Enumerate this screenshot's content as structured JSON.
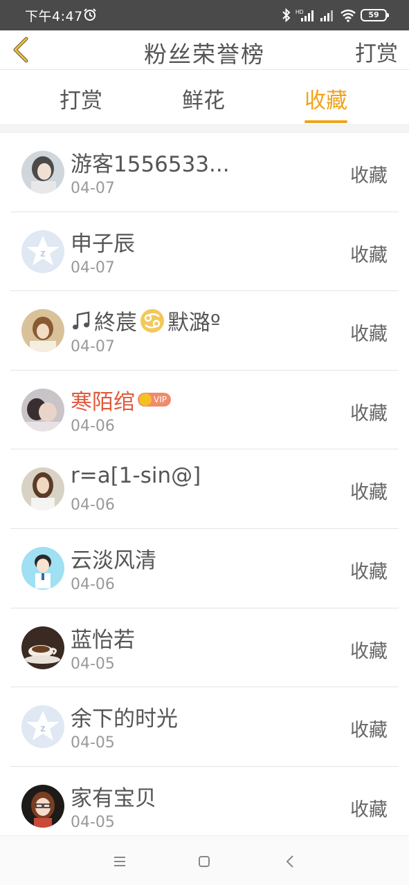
{
  "status_bar": {
    "time": "下午4:47",
    "battery": "59",
    "icons": [
      "alarm-icon",
      "bluetooth-icon",
      "hd-signal-icon",
      "signal-icon",
      "wifi-icon",
      "battery-icon"
    ]
  },
  "header": {
    "title": "粉丝荣誉榜",
    "action": "打赏",
    "back_icon": "chevron-left-icon"
  },
  "tabs": [
    {
      "label": "打赏",
      "active": false
    },
    {
      "label": "鲜花",
      "active": false
    },
    {
      "label": "收藏",
      "active": true
    }
  ],
  "colors": {
    "accent": "#f0a31a",
    "vip_name": "#e05a3c",
    "status_bar": "#4a4a4a"
  },
  "list": [
    {
      "name": "游客1556533...",
      "date": "04-07",
      "action": "收藏",
      "avatar": "photo-avatar"
    },
    {
      "name": "申子辰",
      "date": "04-07",
      "action": "收藏",
      "avatar": "default-qq-avatar"
    },
    {
      "name": "終莀",
      "name_suffix": "默潞º",
      "date": "04-07",
      "action": "收藏",
      "avatar": "photo-avatar",
      "icons": [
        "music-note-icon",
        "cancer-zodiac-icon"
      ]
    },
    {
      "name": "寒陌绾",
      "date": "04-06",
      "action": "收藏",
      "avatar": "photo-avatar",
      "vip": "VIP"
    },
    {
      "name": "r=a[1-sin@]",
      "date": "04-06",
      "action": "收藏",
      "avatar": "photo-avatar"
    },
    {
      "name": "云淡风清",
      "date": "04-06",
      "action": "收藏",
      "avatar": "cartoon-avatar"
    },
    {
      "name": "蓝怡若",
      "date": "04-05",
      "action": "收藏",
      "avatar": "coffee-avatar"
    },
    {
      "name": "余下的时光",
      "date": "04-05",
      "action": "收藏",
      "avatar": "default-qq-avatar"
    },
    {
      "name": "家有宝贝",
      "date": "04-05",
      "action": "收藏",
      "avatar": "cartoon-avatar"
    }
  ],
  "nav_bar": {
    "icons": [
      "menu-icon",
      "home-square-icon",
      "back-triangle-icon"
    ]
  }
}
